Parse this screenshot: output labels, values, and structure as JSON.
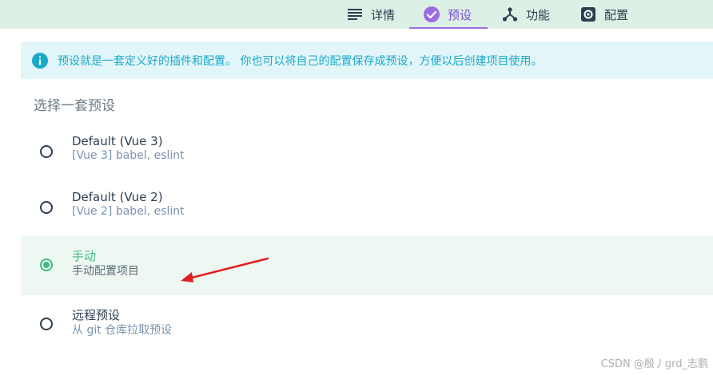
{
  "tabs": [
    {
      "label": "详情",
      "icon": "list-icon"
    },
    {
      "label": "预设",
      "icon": "check-circle-icon",
      "active": true
    },
    {
      "label": "功能",
      "icon": "fork-icon"
    },
    {
      "label": "配置",
      "icon": "gear-icon"
    }
  ],
  "info": {
    "icon": "info-icon",
    "text": "预设就是一套定义好的插件和配置。 你也可以将自己的配置保存成预设，方便以后创建项目使用。"
  },
  "section_title": "选择一套预设",
  "options": [
    {
      "title": "Default (Vue 3)",
      "desc": "[Vue 3] babel, eslint",
      "selected": false
    },
    {
      "title": "Default (Vue 2)",
      "desc": "[Vue 2] babel, eslint",
      "selected": false
    },
    {
      "title": "手动",
      "desc": "手动配置项目",
      "selected": true
    },
    {
      "title": "远程预设",
      "desc": "从 git 仓库拉取预设",
      "selected": false
    }
  ],
  "watermark": "CSDN @殷丿grd_志鹏",
  "colors": {
    "accent_green": "#42b983",
    "accent_purple": "#9b6ddf",
    "info_blue": "#1da9c8",
    "arrow_red": "#e02020"
  }
}
